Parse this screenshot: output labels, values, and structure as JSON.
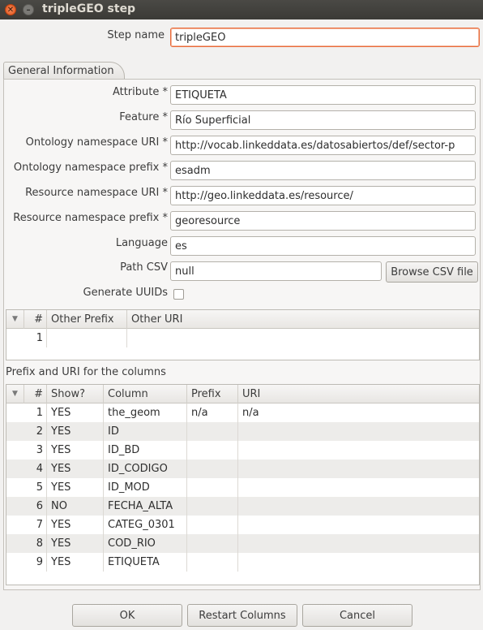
{
  "window": {
    "title": "tripleGEO step"
  },
  "step_name": {
    "label": "Step name",
    "value": "tripleGEO"
  },
  "tabs": [
    {
      "label": "General Information"
    }
  ],
  "form": {
    "attribute": {
      "label": "Attribute *",
      "value": "ETIQUETA"
    },
    "feature": {
      "label": "Feature *",
      "value": "Río Superficial"
    },
    "ontology_uri": {
      "label": "Ontology namespace URI *",
      "value": "http://vocab.linkeddata.es/datosabiertos/def/sector-p"
    },
    "ontology_prefix": {
      "label": "Ontology namespace prefix *",
      "value": "esadm"
    },
    "resource_uri": {
      "label": "Resource namespace URI *",
      "value": "http://geo.linkeddata.es/resource/"
    },
    "resource_prefix": {
      "label": "Resource namespace prefix *",
      "value": "georesource"
    },
    "language": {
      "label": "Language",
      "value": "es"
    },
    "path_csv": {
      "label": "Path CSV",
      "value": "null",
      "browse_label": "Browse CSV file"
    },
    "generate_uuids": {
      "label": "Generate UUIDs",
      "checked": false
    }
  },
  "prefix_table": {
    "headers": [
      "#",
      "Other Prefix",
      "Other URI"
    ],
    "rows": [
      {
        "n": "1",
        "prefix": "",
        "uri": ""
      }
    ]
  },
  "columns_table": {
    "section_label": "Prefix and URI for the columns",
    "headers": [
      "#",
      "Show?",
      "Column",
      "Prefix",
      "URI"
    ],
    "rows": [
      {
        "n": "1",
        "show": "YES",
        "column": "the_geom",
        "prefix": "n/a",
        "uri": "n/a"
      },
      {
        "n": "2",
        "show": "YES",
        "column": "ID",
        "prefix": "",
        "uri": ""
      },
      {
        "n": "3",
        "show": "YES",
        "column": "ID_BD",
        "prefix": "",
        "uri": ""
      },
      {
        "n": "4",
        "show": "YES",
        "column": "ID_CODIGO",
        "prefix": "",
        "uri": ""
      },
      {
        "n": "5",
        "show": "YES",
        "column": "ID_MOD",
        "prefix": "",
        "uri": ""
      },
      {
        "n": "6",
        "show": "NO",
        "column": "FECHA_ALTA",
        "prefix": "",
        "uri": ""
      },
      {
        "n": "7",
        "show": "YES",
        "column": "CATEG_0301",
        "prefix": "",
        "uri": ""
      },
      {
        "n": "8",
        "show": "YES",
        "column": "COD_RIO",
        "prefix": "",
        "uri": ""
      },
      {
        "n": "9",
        "show": "YES",
        "column": "ETIQUETA",
        "prefix": "",
        "uri": ""
      }
    ]
  },
  "buttons": {
    "ok": "OK",
    "restart": "Restart Columns",
    "cancel": "Cancel"
  },
  "colors": {
    "focus_border": "#e96b3a",
    "titlebar": "#3c3b37",
    "close_button": "#e95420"
  }
}
